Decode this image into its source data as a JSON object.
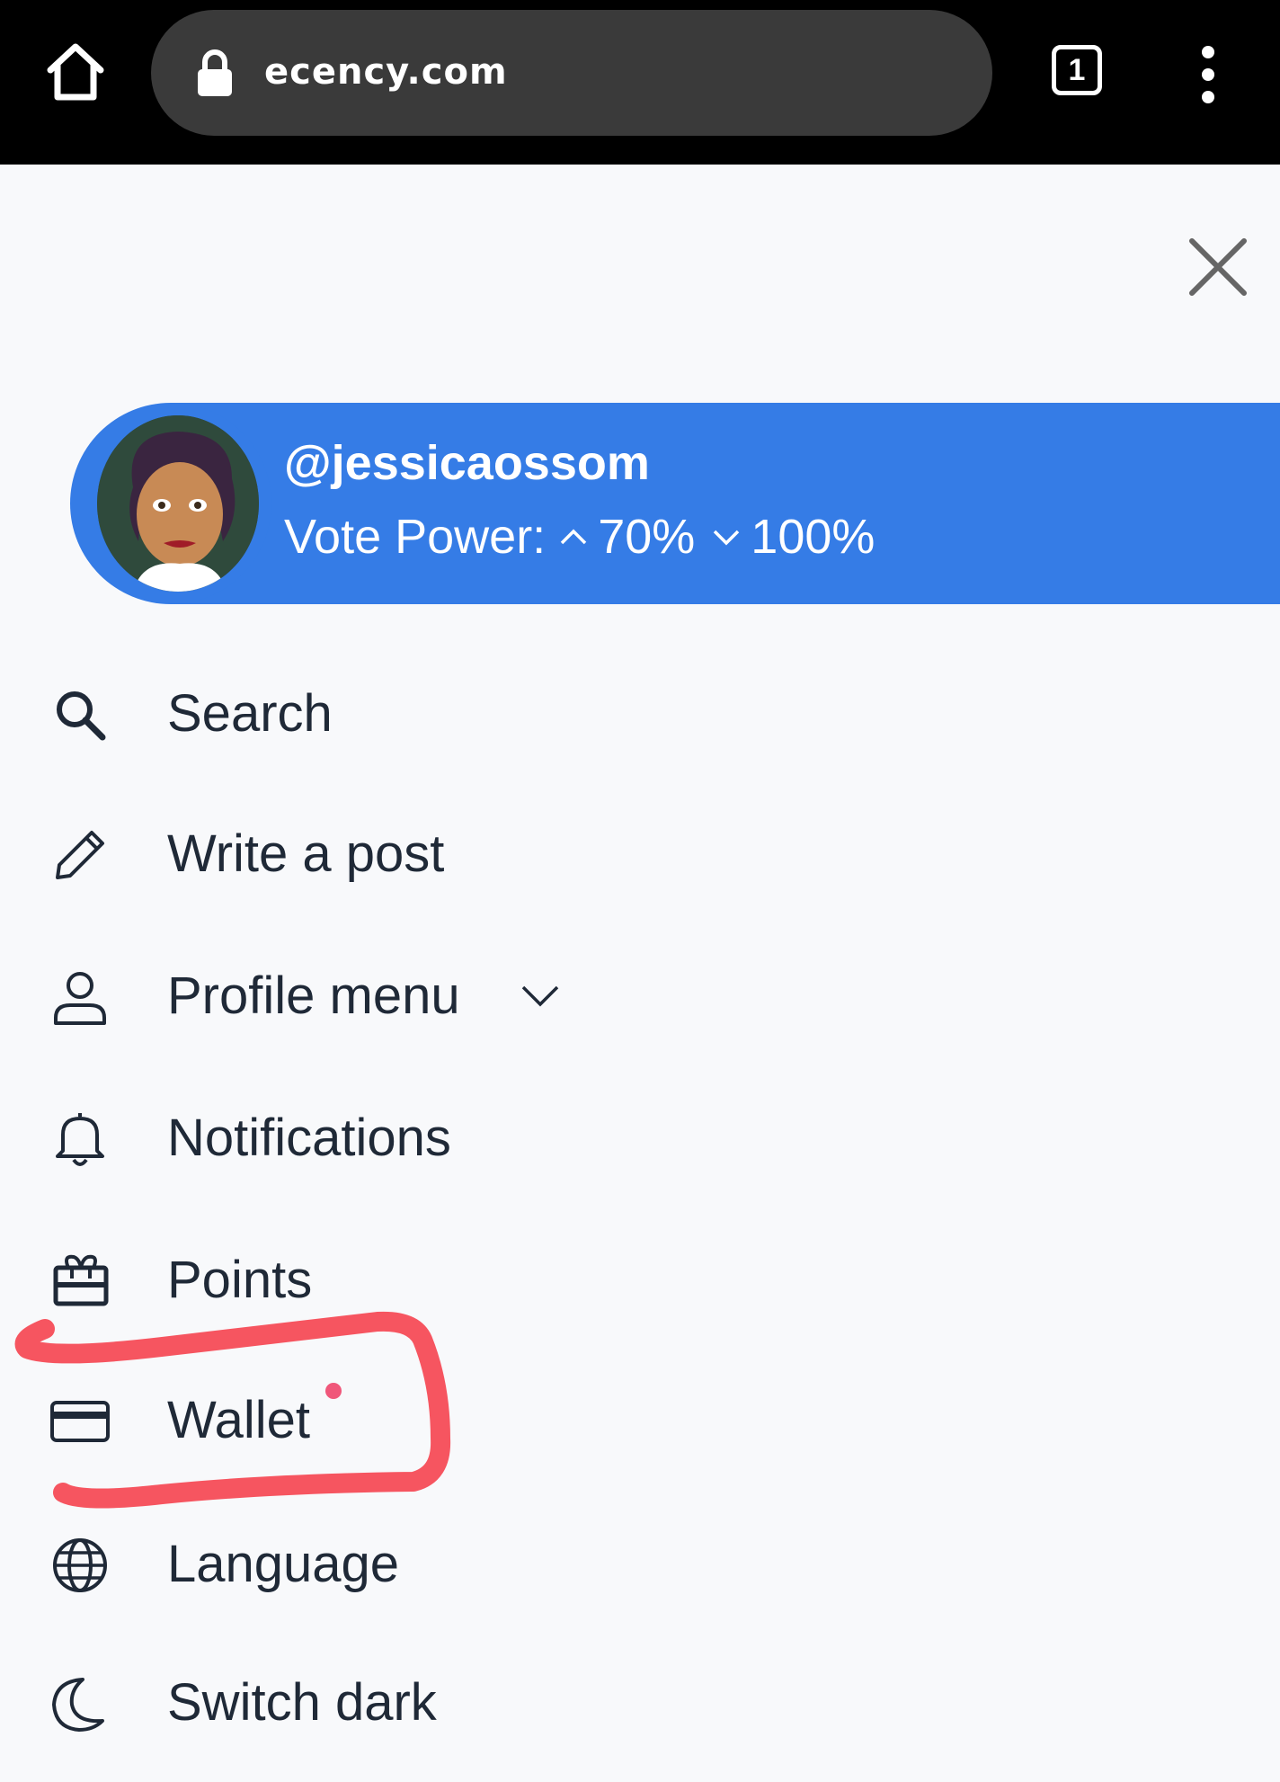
{
  "browser": {
    "url": "ecency.com",
    "tab_count": "1"
  },
  "user": {
    "username": "@jessicaossom",
    "vote_power_label": "Vote Power:",
    "vote_up": "70%",
    "vote_down": "100%"
  },
  "menu": {
    "items": [
      {
        "label": "Search",
        "icon": "search-icon"
      },
      {
        "label": "Write a post",
        "icon": "pencil-icon"
      },
      {
        "label": "Profile menu",
        "icon": "user-icon"
      },
      {
        "label": "Notifications",
        "icon": "bell-icon"
      },
      {
        "label": "Points",
        "icon": "gift-icon"
      },
      {
        "label": "Wallet",
        "icon": "credit-card-icon"
      },
      {
        "label": "Language",
        "icon": "globe-icon"
      },
      {
        "label": "Switch dark",
        "icon": "moon-icon"
      }
    ]
  },
  "colors": {
    "accent": "#357ce6",
    "annotation": "#f65560",
    "notification_dot": "#f0577a"
  }
}
